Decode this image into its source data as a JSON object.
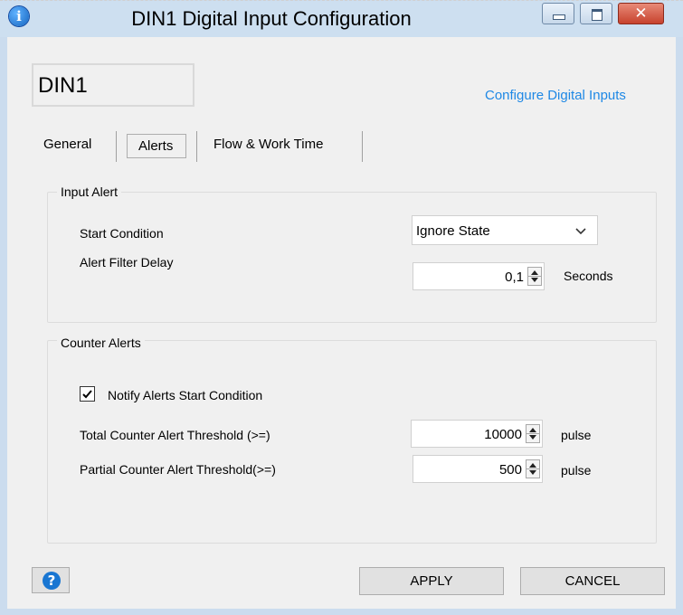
{
  "window": {
    "title": "DIN1 Digital Input Configuration",
    "icon": "info-icon",
    "controls": {
      "minimize": "minimize-icon",
      "maximize": "maximize-icon",
      "close": "close-icon",
      "close_glyph": "✕"
    },
    "accent": "#1e88e5"
  },
  "header": {
    "name_value": "DIN1",
    "configure_link": "Configure Digital Inputs"
  },
  "tabs": [
    {
      "label": "General",
      "selected": false
    },
    {
      "label": "Alerts",
      "selected": true
    },
    {
      "label": "Flow & Work Time",
      "selected": false
    }
  ],
  "input_alert": {
    "legend": "Input Alert",
    "start_condition": {
      "label": "Start Condition",
      "value": "Ignore State"
    },
    "filter_delay": {
      "label": "Alert Filter Delay",
      "value": "0,1",
      "unit": "Seconds"
    }
  },
  "counter_alerts": {
    "legend": "Counter Alerts",
    "notify": {
      "label": "Notify Alerts Start Condition",
      "checked": true
    },
    "total_threshold": {
      "label": "Total Counter Alert Threshold (>=)",
      "value": "10000",
      "unit": "pulse"
    },
    "partial_threshold": {
      "label": "Partial Counter Alert Threshold(>=)",
      "value": "500",
      "unit": "pulse"
    }
  },
  "footer": {
    "help_glyph": "?",
    "apply_label": "APPLY",
    "cancel_label": "CANCEL"
  }
}
